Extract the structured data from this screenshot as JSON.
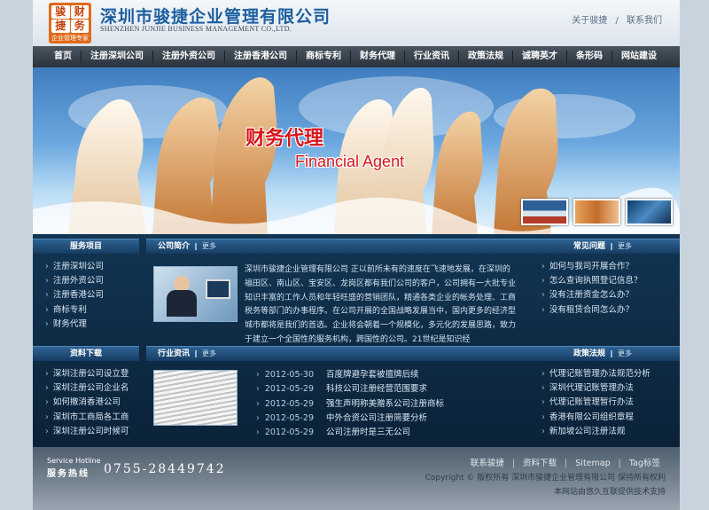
{
  "header": {
    "logo_chars": [
      "骏",
      "财",
      "捷",
      "务"
    ],
    "logo_tag": "企业管理专家",
    "company_cn": "深圳市骏捷企业管理有限公司",
    "company_en": "SHENZHEN JUNJIE BUSINESS MANAGEMENT CO.,LTD.",
    "links": [
      "关于骏捷",
      "联系我们"
    ],
    "link_sep": "/"
  },
  "nav": [
    "首页",
    "注册深圳公司",
    "注册外资公司",
    "注册香港公司",
    "商标专利",
    "财务代理",
    "行业资讯",
    "政策法规",
    "诚聘英才",
    "条形码",
    "网站建设"
  ],
  "banner": {
    "title_cn": "财务代理",
    "title_en": "Financial Agent"
  },
  "services": {
    "title": "服务项目",
    "items": [
      "注册深圳公司",
      "注册外资公司",
      "注册香港公司",
      "商标专利",
      "财务代理"
    ]
  },
  "intro": {
    "title": "公司简介",
    "more": "更多",
    "text": "深圳市骏捷企业管理有限公司 正以前所未有的速度在飞速地发展，在深圳的福田区、南山区、宝安区、龙岗区都有我们公司的客户，公司拥有一大批专业知识丰富的工作人员和年轻旺盛的营销团队，精通各类企业的帐务处理、工商税务等部门的办事程序。在公司开展的全国战略发展当中，国内更多的经济型城市都将是我们的首选。企业将会朝着一个规模化，多元化的发展思路，致力于建立一个全国性的服务机构，跨国性的公司。21世纪是知识经"
  },
  "faq": {
    "title": "常见问题",
    "more": "更多",
    "items": [
      "如何与我司开展合作？",
      "怎么查询执照登记信息？",
      "没有注册资金怎么办？",
      "没有租赁合同怎么办？"
    ]
  },
  "downloads": {
    "title": "资料下载",
    "items": [
      "深圳注册公司设立登",
      "深圳注册公司企业名",
      "如何撤消香港公司",
      "深圳市工商局各工商",
      "深圳注册公司时候可"
    ]
  },
  "news": {
    "title": "行业资讯",
    "more": "更多",
    "items": [
      {
        "date": "2012-05-30",
        "title": "百度牌避孕套被擅牌后续"
      },
      {
        "date": "2012-05-29",
        "title": "科技公司注册经营范围要求"
      },
      {
        "date": "2012-05-29",
        "title": "强生声明称美赠系公司注册商标"
      },
      {
        "date": "2012-05-29",
        "title": "中外合资公司注册简要分析"
      },
      {
        "date": "2012-05-29",
        "title": "公司注册时是三无公司"
      }
    ]
  },
  "policy": {
    "title": "政策法规",
    "more": "更多",
    "items": [
      "代理记账管理办法规范分析",
      "深圳代理记账管理办法",
      "代理记账管理暂行办法",
      "香港有限公司组织章程",
      "新加坡公司注册法规"
    ]
  },
  "footer": {
    "hotline_en": "Service Hotline",
    "hotline_cn": "服务热线",
    "phone": "0755-28449742",
    "links": [
      "联系骏捷",
      "资料下载",
      "Sitemap",
      "Tag标签"
    ],
    "link_sep": "|",
    "copyright": "Copyright © 版权所有 深圳市骏捷企业管理有限公司 保持所有权利",
    "tech": "本网站由悠久互联提供技术支持"
  }
}
